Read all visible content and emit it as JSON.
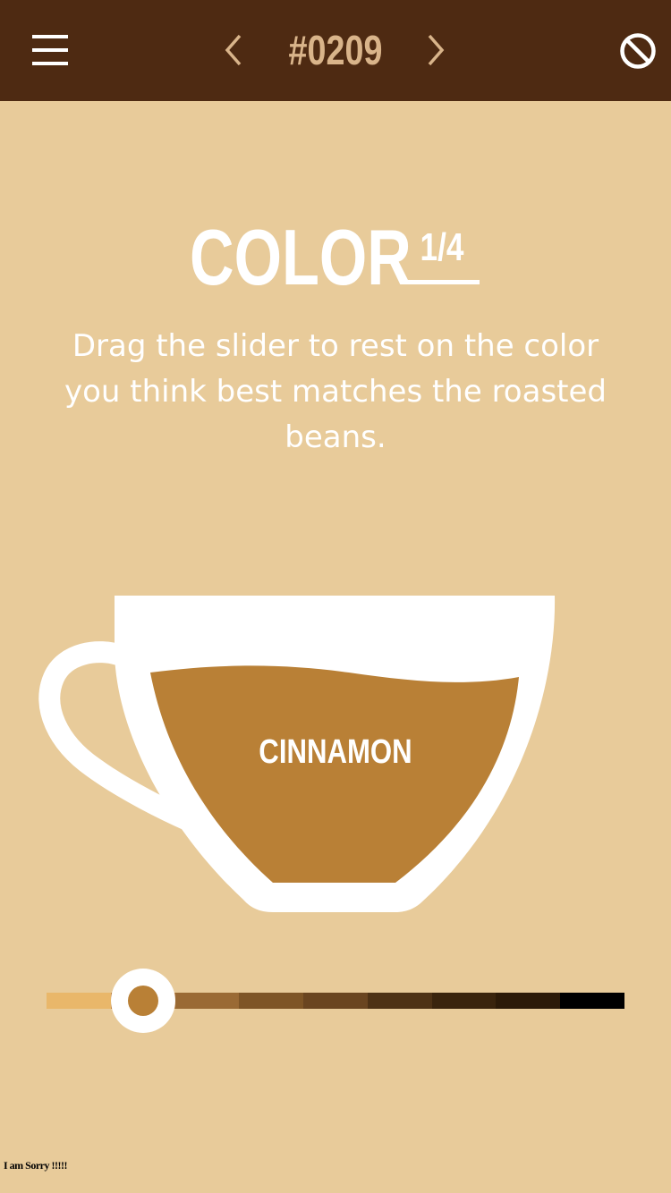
{
  "header": {
    "menu_icon": "hamburger-menu-icon",
    "prev_icon": "chevron-left-icon",
    "sample_number": "#0209",
    "next_icon": "chevron-right-icon",
    "cancel_icon": "prohibited-icon"
  },
  "question": {
    "title": "COLOR",
    "step": "1/4",
    "instructions": "Drag the slider to rest on the color you think best matches the roasted beans."
  },
  "cup": {
    "roast_label": "CINNAMON",
    "coffee_color": "#B98036"
  },
  "slider": {
    "selected_index": 1,
    "segment_colors": [
      "#E9B76A",
      "#BB8040",
      "#9A6A34",
      "#7E5526",
      "#6A4520",
      "#4E3215",
      "#3A240D",
      "#2C1A08",
      "#000000"
    ]
  },
  "footer": {
    "note": "I am Sorry !!!!!"
  },
  "colors": {
    "background": "#E8CB9A",
    "header_bar": "#4E2A12",
    "header_accent": "#D9B48A",
    "text": "#FFFFFF"
  }
}
